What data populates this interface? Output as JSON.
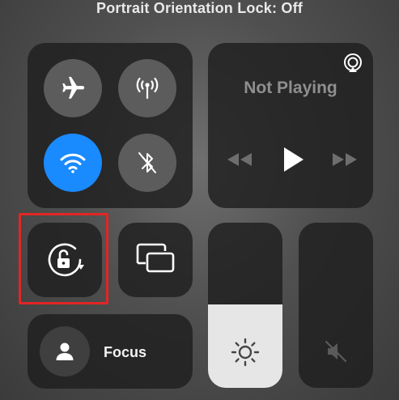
{
  "status": {
    "text": "Portrait Orientation Lock: Off"
  },
  "connectivity": {
    "airplane": {
      "icon": "airplane-icon",
      "active": false
    },
    "cellular": {
      "icon": "antenna-icon",
      "active": false
    },
    "wifi": {
      "icon": "wifi-icon",
      "active": true
    },
    "bluetooth": {
      "icon": "bluetooth-off-icon",
      "active": false
    }
  },
  "media": {
    "title": "Not Playing",
    "airplay_icon": "airplay-icon",
    "controls": [
      "rewind-icon",
      "play-icon",
      "fast-forward-icon"
    ]
  },
  "orientation_lock": {
    "icon": "orientation-lock-unlocked-icon",
    "state": "Off"
  },
  "screen_mirroring": {
    "icon": "screen-mirroring-icon"
  },
  "brightness": {
    "icon": "sun-icon",
    "level": 0.45
  },
  "volume": {
    "icon": "speaker-muted-icon",
    "level": 0.0
  },
  "focus": {
    "label": "Focus",
    "icon": "person-icon"
  },
  "colors": {
    "accent": "#1a8aff",
    "highlight": "#e32525"
  }
}
